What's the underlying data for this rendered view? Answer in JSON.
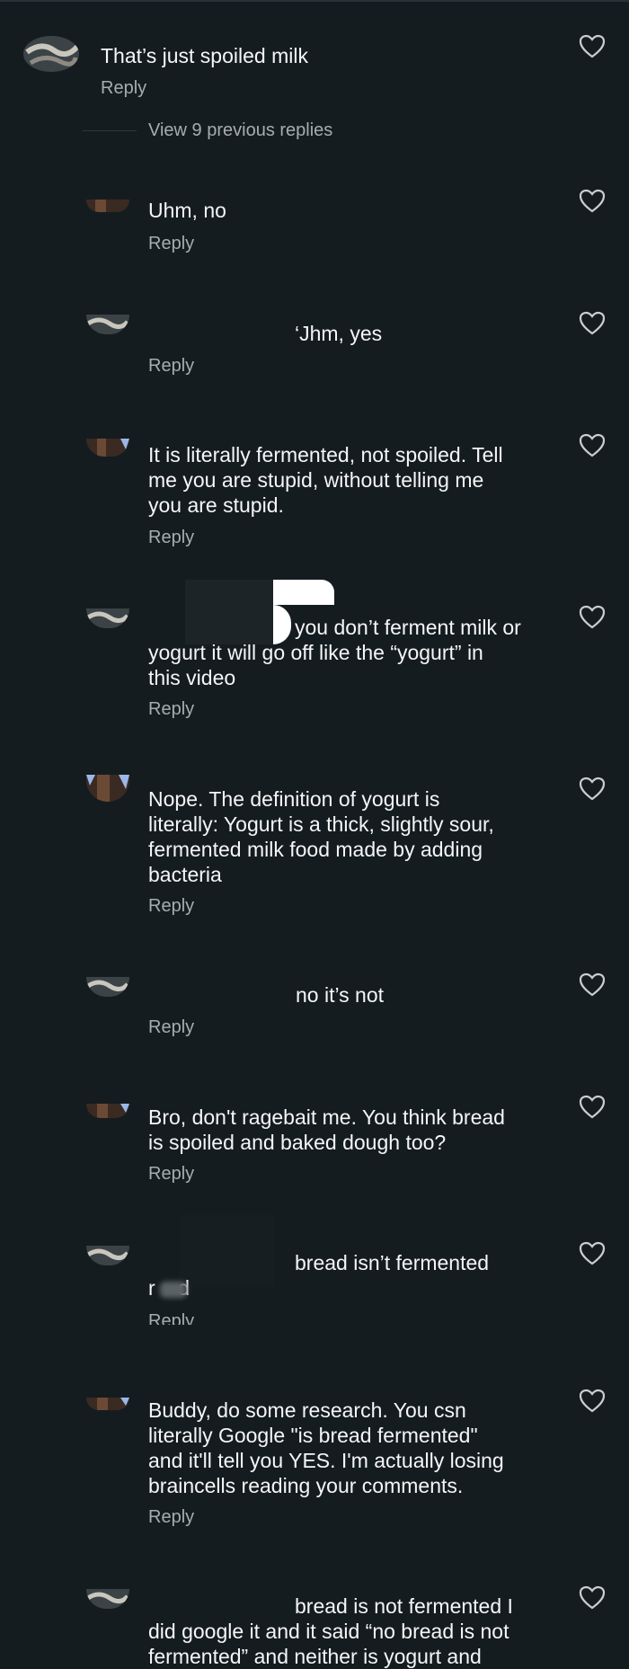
{
  "reply_label": "Reply",
  "view_previous": "View 9 previous replies",
  "colors": {
    "background": "#151c1f",
    "text": "#f4f6f7",
    "muted": "#a6adb0"
  },
  "comments": [
    {
      "text": "That’s just spoiled milk",
      "avatar": "snake-avatar"
    },
    {
      "text": "Uhm, no",
      "avatar": "dark-avatar"
    },
    {
      "text": "‘Jhm, yes",
      "avatar": "snake-avatar"
    },
    {
      "text": "It is literally fermented, not spoiled. Tell\nme you are stupid, without telling me\nyou are stupid.",
      "avatar": "dark-avatar"
    },
    {
      "text_line1": "you don’t ferment milk or",
      "text_rest": "yogurt it will go off like the “yogurt” in\nthis video",
      "avatar": "snake-avatar"
    },
    {
      "text": "Nope. The definition of yogurt is\nliterally: Yogurt is a thick, slightly sour,\nfermented milk food made by adding\nbacteria",
      "avatar": "dark-avatar"
    },
    {
      "text": "no it’s not",
      "avatar": "snake-avatar"
    },
    {
      "text": "Bro, don't ragebait me. You think bread\nis spoiled and baked dough too?",
      "avatar": "dark-avatar"
    },
    {
      "text_line1": "bread isn’t fermented",
      "text_rest": "r    d",
      "avatar": "snake-avatar"
    },
    {
      "text": "Buddy, do some research. You csn\nliterally Google \"is bread fermented\"\nand it'll tell you YES. I'm actually losing\nbraincells reading your comments.",
      "avatar": "dark-avatar"
    },
    {
      "text_line1": "bread is not fermented I",
      "text_rest": "did google it and it said “no bread is not\nfermented” and neither is yogurt and",
      "avatar": "snake-avatar"
    }
  ]
}
